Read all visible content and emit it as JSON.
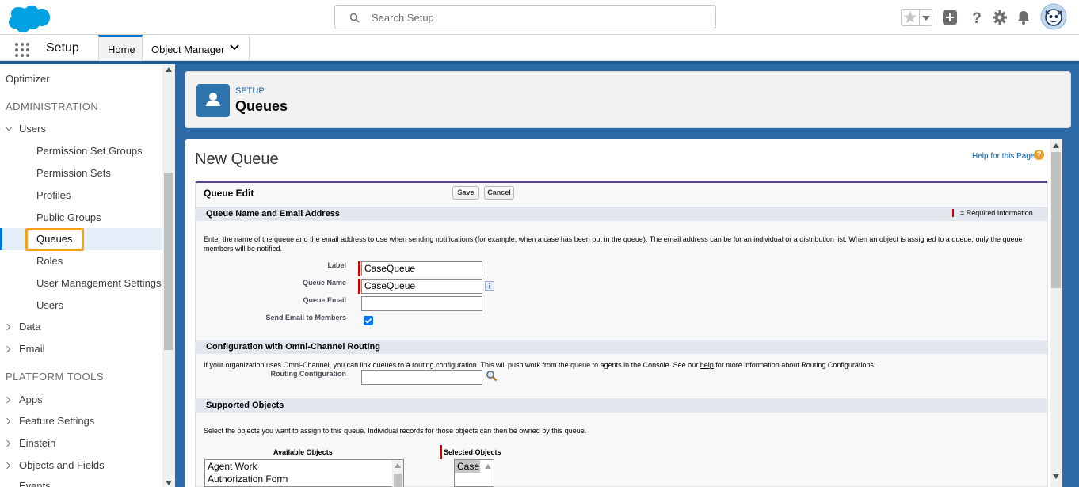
{
  "header": {
    "search_placeholder": "Search Setup"
  },
  "nav": {
    "app_name": "Setup",
    "tabs": [
      {
        "label": "Home",
        "active": true
      },
      {
        "label": "Object Manager",
        "active": false
      }
    ]
  },
  "sidebar": {
    "top_item": "Optimizer",
    "admin_section": "ADMINISTRATION",
    "users_group": "Users",
    "users_children": [
      "Permission Set Groups",
      "Permission Sets",
      "Profiles",
      "Public Groups",
      "Queues",
      "Roles",
      "User Management Settings",
      "Users"
    ],
    "selected": "Queues",
    "admin_groups": [
      "Data",
      "Email"
    ],
    "platform_section": "PLATFORM TOOLS",
    "platform_groups": [
      "Apps",
      "Feature Settings",
      "Einstein",
      "Objects and Fields",
      "Events"
    ]
  },
  "page_header": {
    "crumb": "SETUP",
    "title": "Queues"
  },
  "form": {
    "title": "New Queue",
    "help_link": "Help for this Page",
    "help_icon": "?",
    "block_title": "Queue Edit",
    "save_label": "Save",
    "cancel_label": "Cancel",
    "section1": {
      "title": "Queue Name and Email Address",
      "required_legend": "= Required Information",
      "description": "Enter the name of the queue and the email address to use when sending notifications (for example, when a case has been put in the queue). The email address can be for an individual or a distribution list. When an object is assigned to a queue, only the queue members will be notified.",
      "label_label": "Label",
      "label_value": "CaseQueue",
      "queue_name_label": "Queue Name",
      "queue_name_value": "CaseQueue",
      "queue_email_label": "Queue Email",
      "queue_email_value": "",
      "send_email_label": "Send Email to Members",
      "send_email_checked": true
    },
    "section2": {
      "title": "Configuration with Omni-Channel Routing",
      "description_pre": "If your organization uses Omni-Channel, you can link queues to a routing configuration. This will push work from the queue to agents in the Console. See our",
      "description_link": "help",
      "description_post": "for more information about Routing Configurations.",
      "routing_label": "Routing Configuration",
      "routing_value": ""
    },
    "section3": {
      "title": "Supported Objects",
      "description": "Select the objects you want to assign to this queue. Individual records for those objects can then be owned by this queue.",
      "available_label": "Available Objects",
      "available_items": [
        "Agent Work",
        "Authorization Form"
      ],
      "selected_label": "Selected Objects",
      "selected_items": [
        "Case"
      ]
    }
  }
}
